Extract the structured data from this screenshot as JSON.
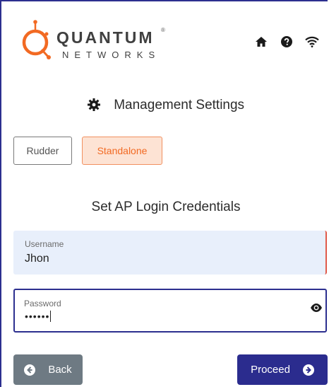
{
  "brand": {
    "name": "QUANTUM",
    "reg_mark": "®",
    "tagline": "NETWORKS",
    "accent_color": "#f26a23",
    "primary_color": "#2c2f8f"
  },
  "header_icons": [
    "home-icon",
    "help-icon",
    "wifi-icon"
  ],
  "section": {
    "title": "Management Settings",
    "icon": "gear-icon"
  },
  "mode_toggle": {
    "options": [
      "Rudder",
      "Standalone"
    ],
    "selected": "Standalone"
  },
  "credentials": {
    "title": "Set AP Login Credentials",
    "username_label": "Username",
    "username_value": "Jhon",
    "password_label": "Password",
    "password_value": "••••••"
  },
  "actions": {
    "back_label": "Back",
    "proceed_label": "Proceed"
  }
}
